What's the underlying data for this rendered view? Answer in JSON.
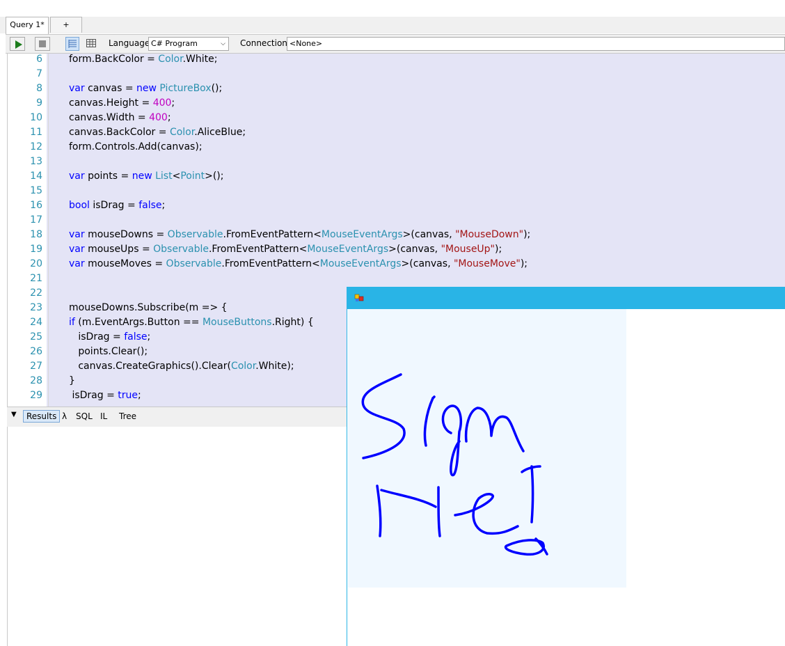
{
  "tabs": [
    {
      "label": "Query 1*"
    },
    {
      "label": "+"
    }
  ],
  "toolbar": {
    "language_label": "Language",
    "language_value": "C# Program",
    "connection_label": "Connection",
    "connection_value": "<None>"
  },
  "editor": {
    "lines": [
      {
        "num": "6",
        "code": "form.BackColor = Color.White;"
      },
      {
        "num": "7",
        "code": ""
      },
      {
        "num": "8",
        "code": "var canvas = new PictureBox();"
      },
      {
        "num": "9",
        "code": "canvas.Height = 400;"
      },
      {
        "num": "10",
        "code": "canvas.Width = 400;"
      },
      {
        "num": "11",
        "code": "canvas.BackColor = Color.AliceBlue;"
      },
      {
        "num": "12",
        "code": "form.Controls.Add(canvas);"
      },
      {
        "num": "13",
        "code": ""
      },
      {
        "num": "14",
        "code": "var points = new List<Point>();"
      },
      {
        "num": "15",
        "code": ""
      },
      {
        "num": "16",
        "code": "bool isDrag = false;"
      },
      {
        "num": "17",
        "code": ""
      },
      {
        "num": "18",
        "code": "var mouseDowns = Observable.FromEventPattern<MouseEventArgs>(canvas, \"MouseDown\");"
      },
      {
        "num": "19",
        "code": "var mouseUps = Observable.FromEventPattern<MouseEventArgs>(canvas, \"MouseUp\");"
      },
      {
        "num": "20",
        "code": "var mouseMoves = Observable.FromEventPattern<MouseEventArgs>(canvas, \"MouseMove\");"
      },
      {
        "num": "21",
        "code": ""
      },
      {
        "num": "22",
        "code": ""
      },
      {
        "num": "23",
        "code": "mouseDowns.Subscribe(m => {"
      },
      {
        "num": "24",
        "code": "if (m.EventArgs.Button == MouseButtons.Right) {"
      },
      {
        "num": "25",
        "code": "   isDrag = false;"
      },
      {
        "num": "26",
        "code": "   points.Clear();"
      },
      {
        "num": "27",
        "code": "   canvas.CreateGraphics().Clear(Color.White);"
      },
      {
        "num": "28",
        "code": "}"
      },
      {
        "num": "29",
        "code": " isDrag = true;"
      }
    ],
    "keywords": [
      "var",
      "new",
      "bool",
      "false",
      "true",
      "if"
    ],
    "types": [
      "Color",
      "PictureBox",
      "List",
      "Point",
      "Observable",
      "MouseEventArgs",
      "MouseButtons"
    ]
  },
  "result_tabs": [
    {
      "label": "Results",
      "active": true
    },
    {
      "label": "λ"
    },
    {
      "label": "SQL"
    },
    {
      "label": "IL"
    },
    {
      "label": "Tree"
    }
  ],
  "form_window": {
    "titlebar_color": "#29b4e6",
    "canvas_color": "#f0f8ff",
    "ink_color": "#0000ff",
    "handwriting": "Sign Me!"
  },
  "colors": {
    "keyword": "#0000ff",
    "type": "#2b91af",
    "number": "#c000c0",
    "string": "#a31515",
    "selection": "#e4e4f6"
  }
}
